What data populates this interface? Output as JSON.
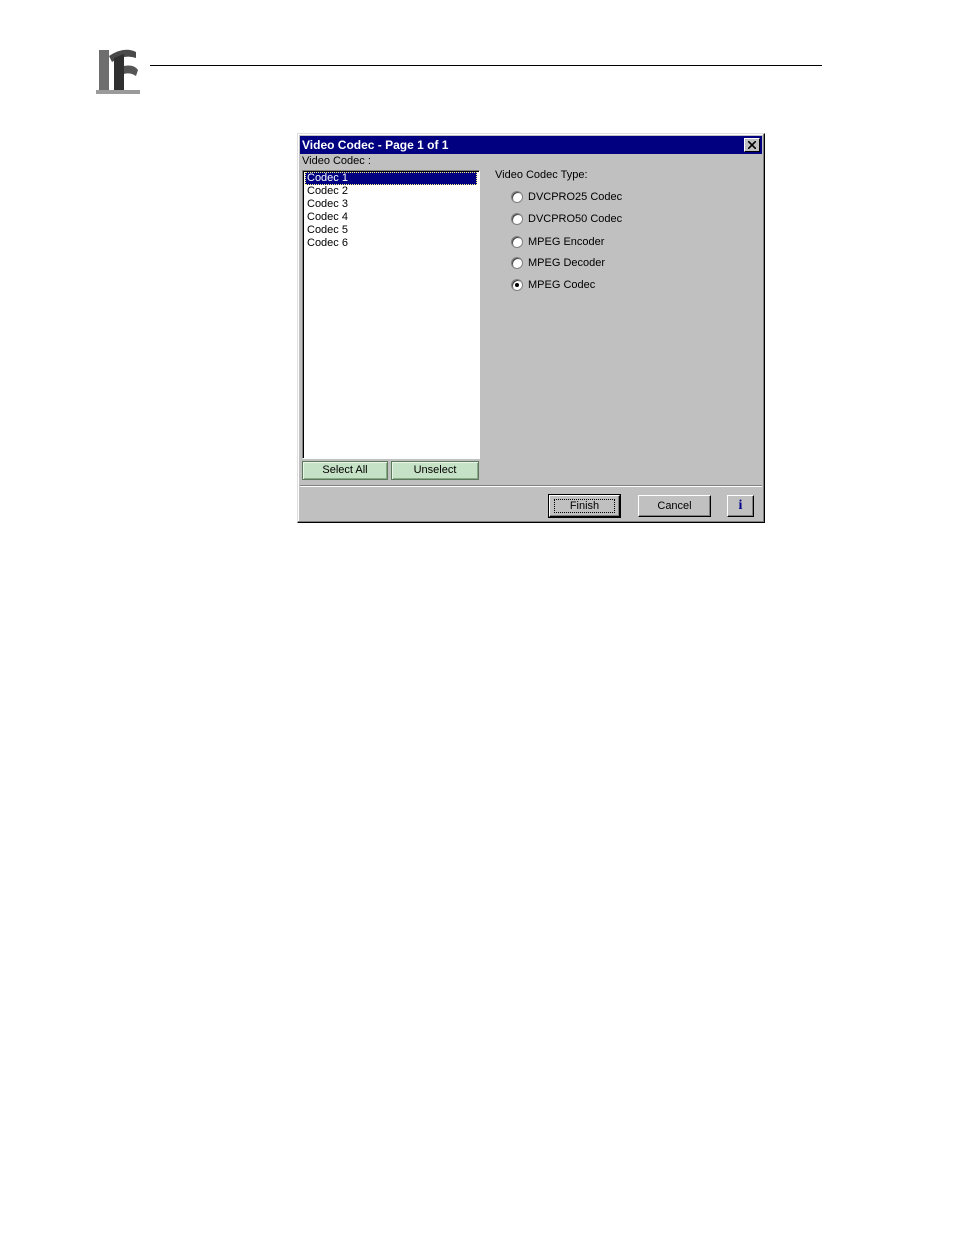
{
  "dialog": {
    "title": "Video Codec - Page 1 of 1",
    "list_label": "Video Codec :",
    "codecs": [
      "Codec 1",
      "Codec 2",
      "Codec 3",
      "Codec 4",
      "Codec 5",
      "Codec 6"
    ],
    "selected_codec": "Codec 1",
    "select_all_label": "Select All",
    "unselect_label": "Unselect",
    "type_label": "Video Codec Type:",
    "types": [
      "DVCPRO25 Codec",
      "DVCPRO50 Codec",
      "MPEG Encoder",
      "MPEG Decoder",
      "MPEG Codec"
    ],
    "selected_type": "MPEG Codec",
    "finish_label": "Finish",
    "cancel_label": "Cancel",
    "info_label": "i"
  },
  "colors": {
    "titlebar": "#000080",
    "dialog_bg": "#c0c0c0",
    "green_button": "#c6e2c6"
  }
}
